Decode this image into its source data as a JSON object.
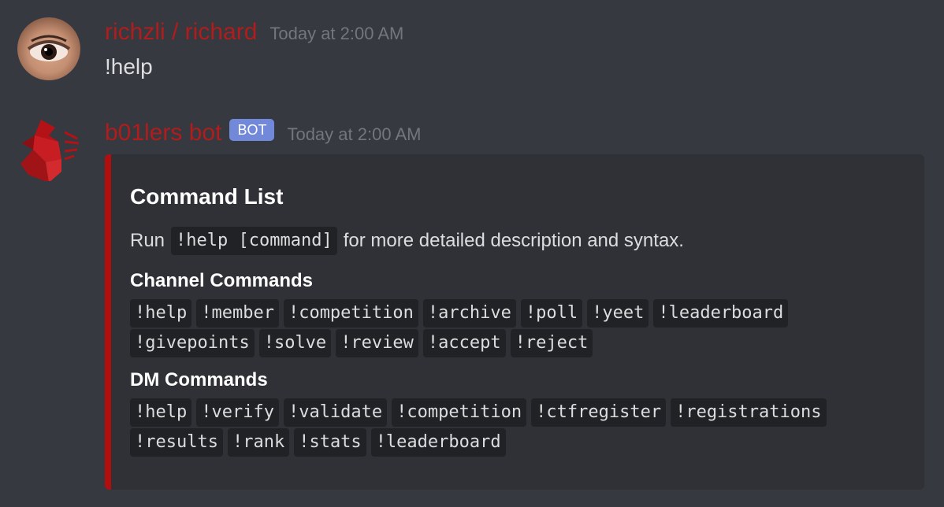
{
  "messages": {
    "user": {
      "username": "richzli / richard",
      "timestamp": "Today at 2:00 AM",
      "text": "!help"
    },
    "bot": {
      "username": "b01lers bot",
      "tag": "BOT",
      "timestamp": "Today at 2:00 AM"
    }
  },
  "embed": {
    "title": "Command List",
    "desc_prefix": "Run",
    "desc_code": "!help [command]",
    "desc_suffix": "for more detailed description and syntax.",
    "channel_title": "Channel Commands",
    "channel_commands": [
      "!help",
      "!member",
      "!competition",
      "!archive",
      "!poll",
      "!yeet",
      "!leaderboard",
      "!givepoints",
      "!solve",
      "!review",
      "!accept",
      "!reject"
    ],
    "dm_title": "DM Commands",
    "dm_commands": [
      "!help",
      "!verify",
      "!validate",
      "!competition",
      "!ctfregister",
      "!registrations",
      "!results",
      "!rank",
      "!stats",
      "!leaderboard"
    ]
  },
  "colors": {
    "background": "#36393f",
    "username": "#b11c1c",
    "embed_border": "#b30e0e",
    "bot_tag": "#7289da"
  },
  "icons": {
    "user_avatar": "eye-avatar-icon",
    "bot_avatar": "red-dragon-logo-icon"
  }
}
